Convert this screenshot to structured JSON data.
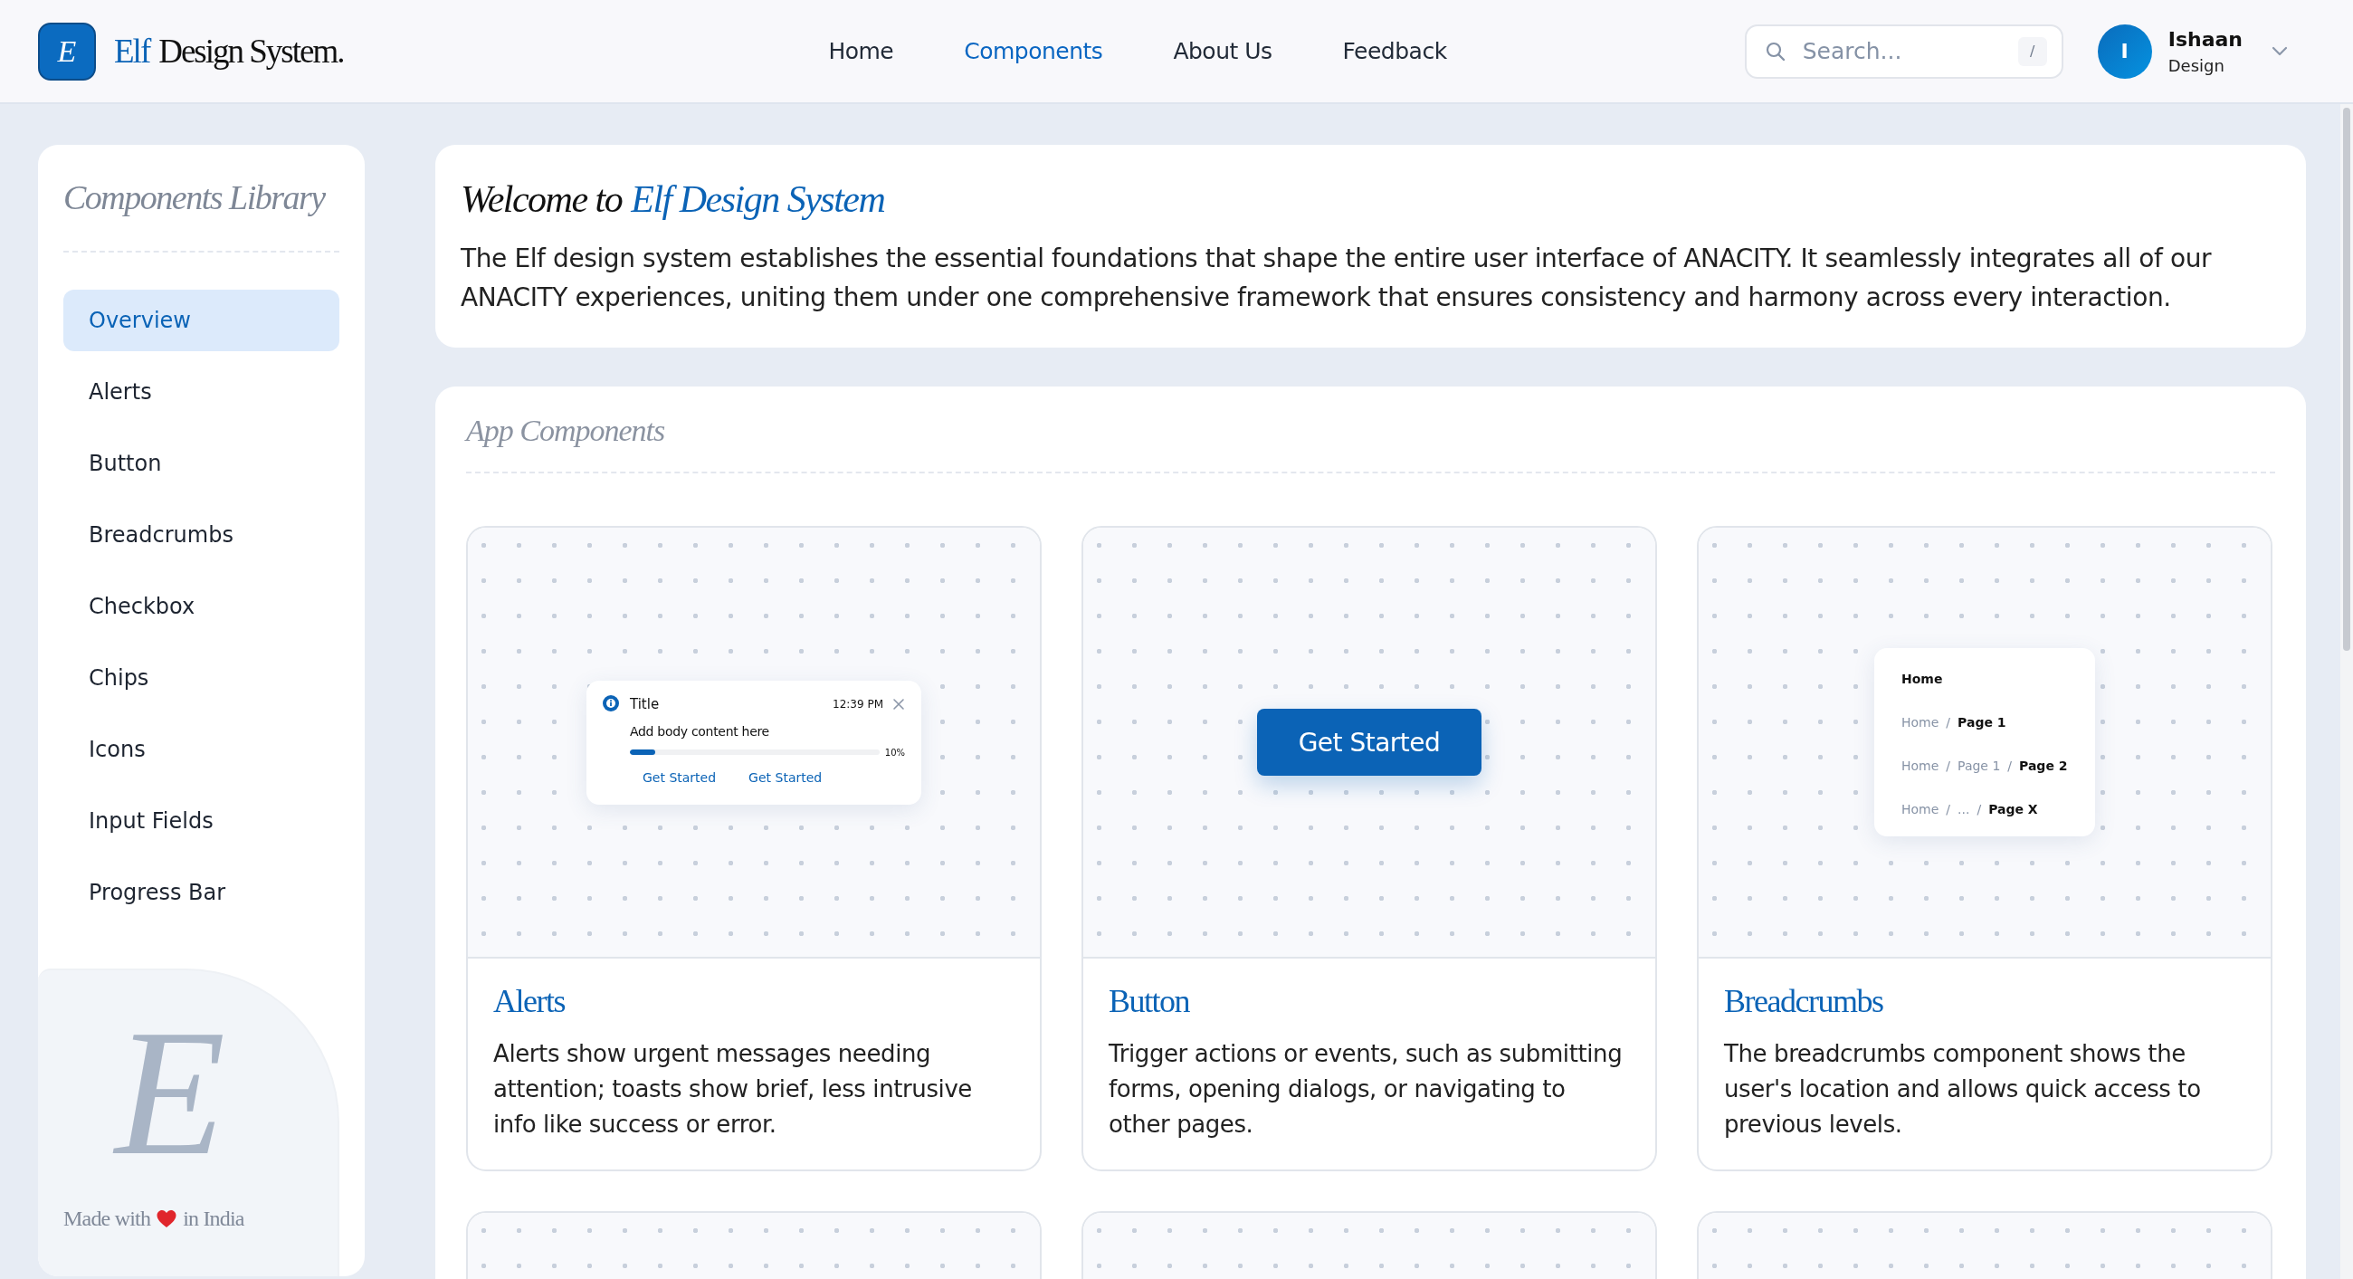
{
  "header": {
    "logo_letter": "E",
    "brand_prefix": "Elf",
    "brand_rest": "Design System.",
    "nav": [
      {
        "label": "Home",
        "selected": false
      },
      {
        "label": "Components",
        "selected": true
      },
      {
        "label": "About Us",
        "selected": false
      },
      {
        "label": "Feedback",
        "selected": false
      }
    ],
    "search": {
      "placeholder": "Search...",
      "shortcut": "/"
    },
    "user": {
      "initial": "I",
      "name": "Ishaan",
      "role": "Design"
    }
  },
  "sidebar": {
    "title": "Components Library",
    "items": [
      {
        "label": "Overview",
        "selected": true
      },
      {
        "label": "Alerts",
        "selected": false
      },
      {
        "label": "Button",
        "selected": false
      },
      {
        "label": "Breadcrumbs",
        "selected": false
      },
      {
        "label": "Checkbox",
        "selected": false
      },
      {
        "label": "Chips",
        "selected": false
      },
      {
        "label": "Icons",
        "selected": false
      },
      {
        "label": "Input Fields",
        "selected": false
      },
      {
        "label": "Progress Bar",
        "selected": false
      }
    ],
    "footer": {
      "mark": "E",
      "before": "Made with",
      "after": "in India"
    }
  },
  "welcome": {
    "title_prefix": "Welcome to",
    "title_highlight": "Elf Design System",
    "text": "The Elf design system establishes the essential foundations that shape the entire user interface of ANACITY. It seamlessly integrates all of our ANACITY experiences, uniting them under one comprehensive framework that ensures consistency and harmony across every interaction."
  },
  "components": {
    "heading": "App Components",
    "cards": [
      {
        "title": "Alerts",
        "description": "Alerts show urgent messages needing attention; toasts show brief, less intrusive info like success or error.",
        "preview": {
          "kind": "alert",
          "title": "Title",
          "time": "12:39 PM",
          "body": "Add body content here",
          "level": 0.1,
          "reading": "10%",
          "actions": [
            "Get Started",
            "Get Started"
          ]
        }
      },
      {
        "title": "Button",
        "description": "Trigger actions or events, such as submitting forms, opening dialogs, or navigating to other pages.",
        "preview": {
          "kind": "button",
          "label": "Get Started"
        }
      },
      {
        "title": "Breadcrumbs",
        "description": "The breadcrumbs component shows the user's location and allows quick access to previous levels.",
        "preview": {
          "kind": "breadcrumbs",
          "trails": [
            [
              {
                "kind": "crumb",
                "text": "Home",
                "current": true
              }
            ],
            [
              {
                "kind": "crumb",
                "text": "Home",
                "current": false
              },
              {
                "kind": "separator",
                "text": "/"
              },
              {
                "kind": "crumb",
                "text": "Page 1",
                "current": true
              }
            ],
            [
              {
                "kind": "crumb",
                "text": "Home",
                "current": false
              },
              {
                "kind": "separator",
                "text": "/"
              },
              {
                "kind": "crumb",
                "text": "Page 1",
                "current": false
              },
              {
                "kind": "separator",
                "text": "/"
              },
              {
                "kind": "crumb",
                "text": "Page 2",
                "current": true
              }
            ],
            [
              {
                "kind": "crumb",
                "text": "Home",
                "current": false
              },
              {
                "kind": "separator",
                "text": "/"
              },
              {
                "kind": "crumb",
                "text": "...",
                "current": false
              },
              {
                "kind": "separator",
                "text": "/"
              },
              {
                "kind": "crumb",
                "text": "Page X",
                "current": true
              }
            ]
          ]
        }
      },
      {
        "preview": {
          "kind": "empty"
        }
      },
      {
        "preview": {
          "kind": "empty"
        }
      },
      {
        "preview": {
          "kind": "empty"
        }
      }
    ]
  }
}
